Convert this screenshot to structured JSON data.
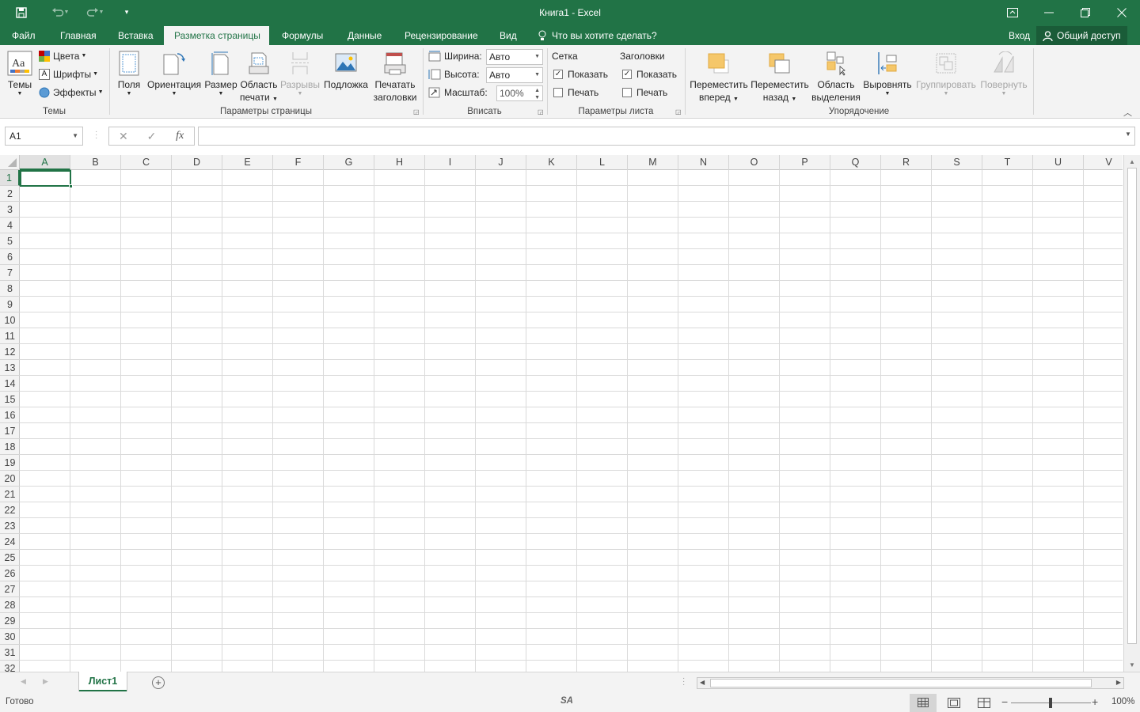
{
  "window": {
    "title": "Книга1 - Excel"
  },
  "qat": {
    "save_icon": "save-icon",
    "undo_icon": "undo-icon",
    "redo_icon": "redo-icon",
    "customize_icon": "customize-qat-icon"
  },
  "tabs": [
    {
      "label": "Файл"
    },
    {
      "label": "Главная"
    },
    {
      "label": "Вставка"
    },
    {
      "label": "Разметка страницы"
    },
    {
      "label": "Формулы"
    },
    {
      "label": "Данные"
    },
    {
      "label": "Рецензирование"
    },
    {
      "label": "Вид"
    }
  ],
  "active_tab": "Разметка страницы",
  "tell_me": "Что вы хотите сделать?",
  "signin": "Вход",
  "share": "Общий доступ",
  "ribbon": {
    "themes": {
      "label": "Темы",
      "btn_themes": "Темы",
      "colors": "Цвета",
      "fonts": "Шрифты",
      "effects": "Эффекты"
    },
    "page_setup": {
      "label": "Параметры страницы",
      "margins": "Поля",
      "orientation": "Ориентация",
      "size": "Размер",
      "print_area_1": "Область",
      "print_area_2": "печати",
      "breaks": "Разрывы",
      "background": "Подложка",
      "print_titles_1": "Печатать",
      "print_titles_2": "заголовки"
    },
    "scale_to_fit": {
      "label": "Вписать",
      "width_label": "Ширина:",
      "width_value": "Авто",
      "height_label": "Высота:",
      "height_value": "Авто",
      "scale_label": "Масштаб:",
      "scale_value": "100%"
    },
    "sheet_options": {
      "label": "Параметры листа",
      "gridlines": "Сетка",
      "headings": "Заголовки",
      "show": "Показать",
      "print": "Печать",
      "gridlines_show": true,
      "gridlines_print": false,
      "headings_show": true,
      "headings_print": false
    },
    "arrange": {
      "label": "Упорядочение",
      "bring_forward_1": "Переместить",
      "bring_forward_2": "вперед",
      "send_backward_1": "Переместить",
      "send_backward_2": "назад",
      "selection_pane_1": "Область",
      "selection_pane_2": "выделения",
      "align": "Выровнять",
      "group": "Группировать",
      "rotate": "Повернуть"
    }
  },
  "formula_bar": {
    "name_box": "A1",
    "cancel": "✕",
    "enter": "✓",
    "fx": "fx",
    "formula": ""
  },
  "columns": [
    "A",
    "B",
    "C",
    "D",
    "E",
    "F",
    "G",
    "H",
    "I",
    "J",
    "K",
    "L",
    "M",
    "N",
    "O",
    "P",
    "Q",
    "R",
    "S",
    "T",
    "U",
    "V"
  ],
  "rows": [
    "1",
    "2",
    "3",
    "4",
    "5",
    "6",
    "7",
    "8",
    "9",
    "10",
    "11",
    "12",
    "13",
    "14",
    "15",
    "16",
    "17",
    "18",
    "19",
    "20",
    "21",
    "22",
    "23",
    "24",
    "25",
    "26",
    "27",
    "28",
    "29",
    "30",
    "31",
    "32"
  ],
  "selected_cell": "A1",
  "sheets": [
    {
      "name": "Лист1",
      "active": true
    }
  ],
  "status": {
    "ready": "Готово",
    "zoom": "100%",
    "zoom_level": 100
  },
  "colors": {
    "accent": "#217346"
  }
}
